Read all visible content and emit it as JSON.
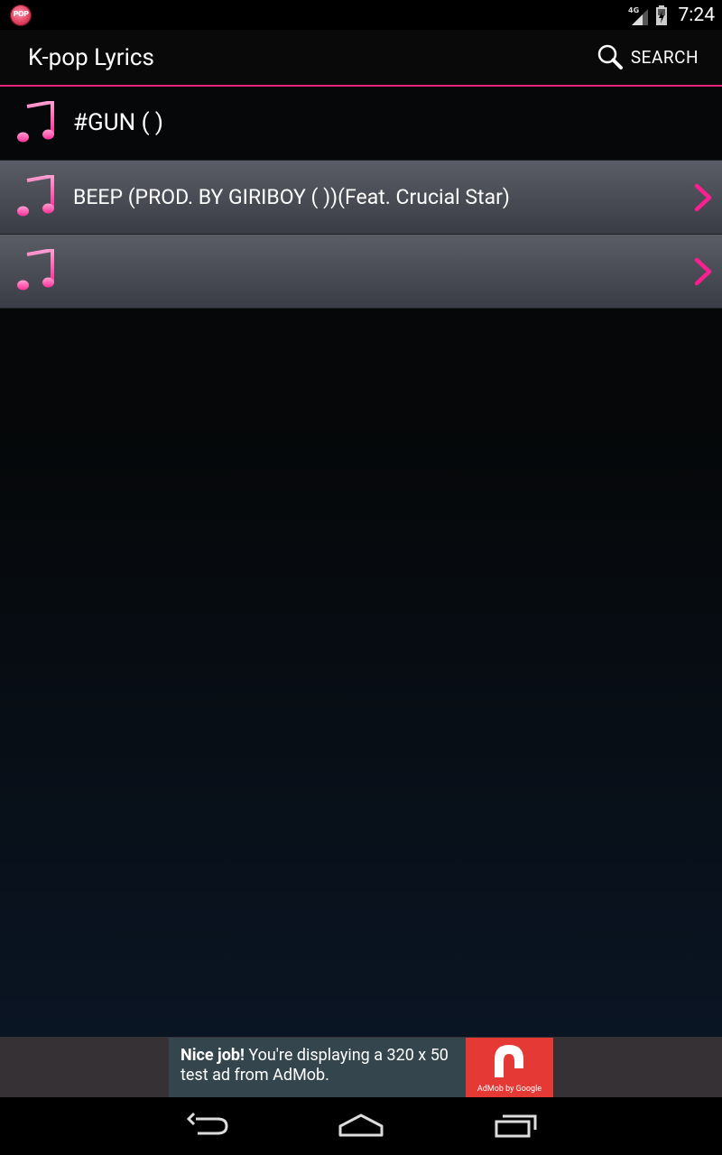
{
  "status_bar": {
    "network_label": "4G",
    "time": "7:24",
    "app_icon_text": "POP"
  },
  "action_bar": {
    "title": "K-pop Lyrics",
    "search_label": "SEARCH"
  },
  "songs": [
    {
      "title": "#GUN (  )",
      "has_chevron": false,
      "highlighted": false
    },
    {
      "title": "BEEP (PROD. BY GIRIBOY (    ))(Feat. Crucial Star)",
      "has_chevron": true,
      "highlighted": true
    },
    {
      "title": "",
      "has_chevron": true,
      "highlighted": true
    }
  ],
  "ad": {
    "headline": "Nice job!",
    "body": " You're displaying a 320 x 50 test ad from AdMob.",
    "logo_caption": "AdMob by Google"
  },
  "colors": {
    "accent": "#e6237d",
    "note_icon": "#ff4fae",
    "ad_red": "#e53935"
  },
  "nav": {
    "back": "back-icon",
    "home": "home-icon",
    "recents": "recents-icon"
  }
}
